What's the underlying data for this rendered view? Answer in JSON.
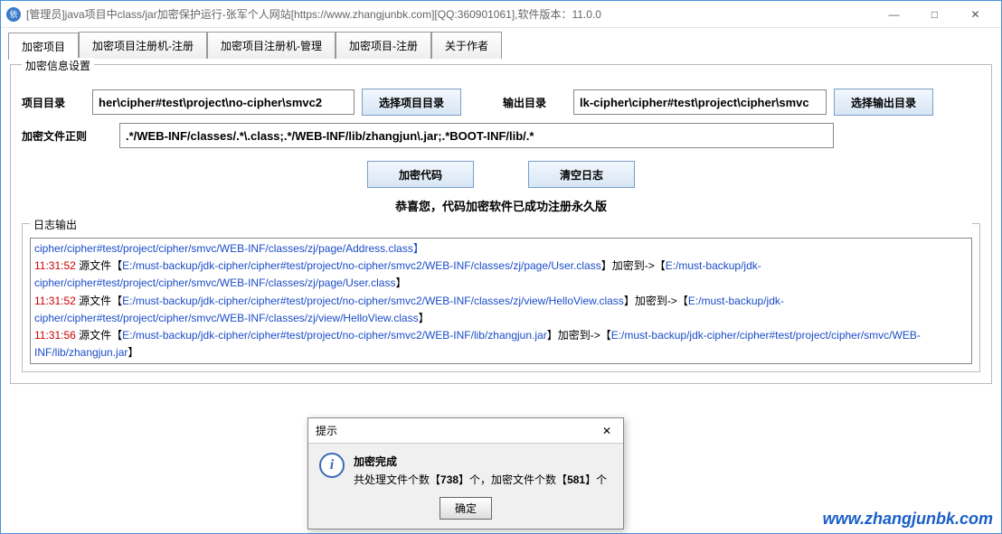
{
  "window": {
    "title": "[管理员]java项目中class/jar加密保护运行-张军个人网站[https://www.zhangjunbk.com][QQ:360901061],软件版本：11.0.0",
    "minimize": "—",
    "maximize": "□",
    "close": "✕"
  },
  "tabs": [
    {
      "label": "加密项目",
      "active": true
    },
    {
      "label": "加密项目注册机-注册",
      "active": false
    },
    {
      "label": "加密项目注册机-管理",
      "active": false
    },
    {
      "label": "加密项目-注册",
      "active": false
    },
    {
      "label": "关于作者",
      "active": false
    }
  ],
  "settings": {
    "legend": "加密信息设置",
    "project_dir_label": "项目目录",
    "project_dir_value": "her\\cipher#test\\project\\no-cipher\\smvc2",
    "project_dir_btn": "选择项目目录",
    "output_dir_label": "输出目录",
    "output_dir_value": "lk-cipher\\cipher#test\\project\\cipher\\smvc",
    "output_dir_btn": "选择输出目录",
    "regex_label": "加密文件正则",
    "regex_value": ".*/WEB-INF/classes/.*\\.class;.*/WEB-INF/lib/zhangjun\\.jar;.*BOOT-INF/lib/.*"
  },
  "actions": {
    "encrypt_btn": "加密代码",
    "clear_btn": "清空日志"
  },
  "status_line": "恭喜您，代码加密软件已成功注册永久版",
  "log": {
    "legend": "日志输出",
    "lines": [
      {
        "ts": "",
        "text_before": "",
        "path": "cipher/cipher#test/project/cipher/smvc/WEB-INF/classes/zj/page/Address.class】"
      },
      {
        "ts": "11:31:52",
        "text_before": " 源文件【",
        "path1": "E:/must-backup/jdk-cipher/cipher#test/project/no-cipher/smvc2/WEB-INF/classes/zj/page/User.class",
        "mid": "】加密到->【",
        "path2": "E:/must-backup/jdk-cipher/cipher#test/project/cipher/smvc/WEB-INF/classes/zj/page/User.class",
        "suffix": "】"
      },
      {
        "ts": "11:31:52",
        "text_before": " 源文件【",
        "path1": "E:/must-backup/jdk-cipher/cipher#test/project/no-cipher/smvc2/WEB-INF/classes/zj/view/HelloView.class",
        "mid": "】加密到->【",
        "path2": "E:/must-backup/jdk-cipher/cipher#test/project/cipher/smvc/WEB-INF/classes/zj/view/HelloView.class",
        "suffix": "】"
      },
      {
        "ts": "11:31:56",
        "text_before": " 源文件【",
        "path1": "E:/must-backup/jdk-cipher/cipher#test/project/no-cipher/smvc2/WEB-INF/lib/zhangjun.jar",
        "mid": "】加密到->【",
        "path2": "E:/must-backup/jdk-cipher/cipher#test/project/cipher/smvc/WEB-INF/lib/zhangjun.jar",
        "suffix": "】"
      }
    ]
  },
  "dialog": {
    "title": "提示",
    "heading": "加密完成",
    "message_prefix": "共处理文件个数【",
    "processed": "738",
    "message_mid": "】个，加密文件个数【",
    "encrypted": "581",
    "message_suffix": "】个",
    "ok": "确定"
  },
  "watermark": "www.zhangjunbk.com"
}
